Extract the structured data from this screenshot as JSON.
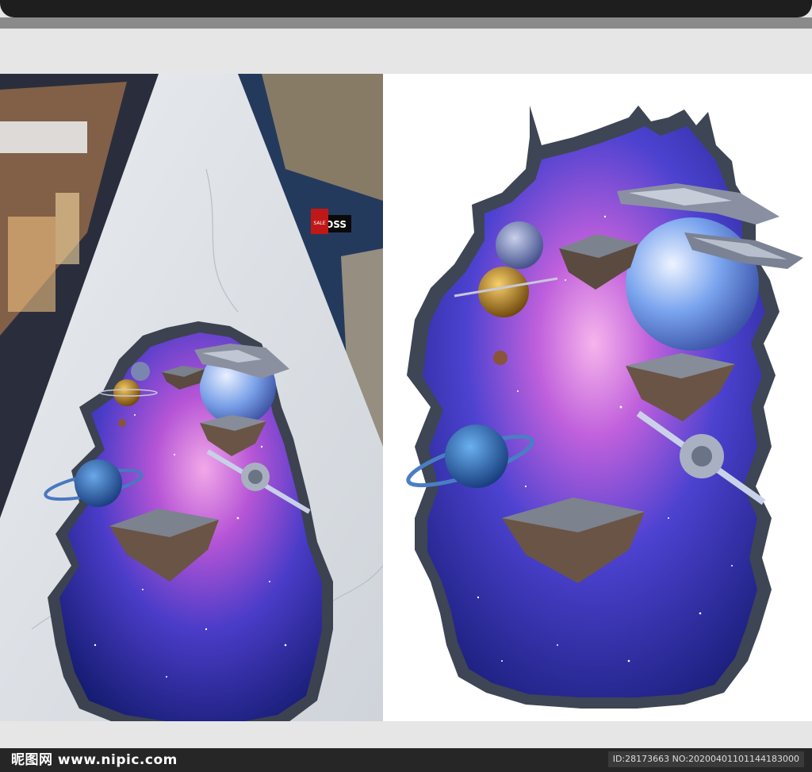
{
  "mall_signs": {
    "store_sign": "BOSS",
    "sale_sign": "SALE"
  },
  "footer": {
    "site_logo": "昵图网 www.nipic.com",
    "image_id": "ID:28173663 NO:20200401101144183000"
  },
  "colors": {
    "footer_bg": "#262626",
    "space_deep": "#141a70",
    "space_glow": "#c45ad8",
    "rock": "#545a66",
    "floor": "#dfe3e8"
  }
}
